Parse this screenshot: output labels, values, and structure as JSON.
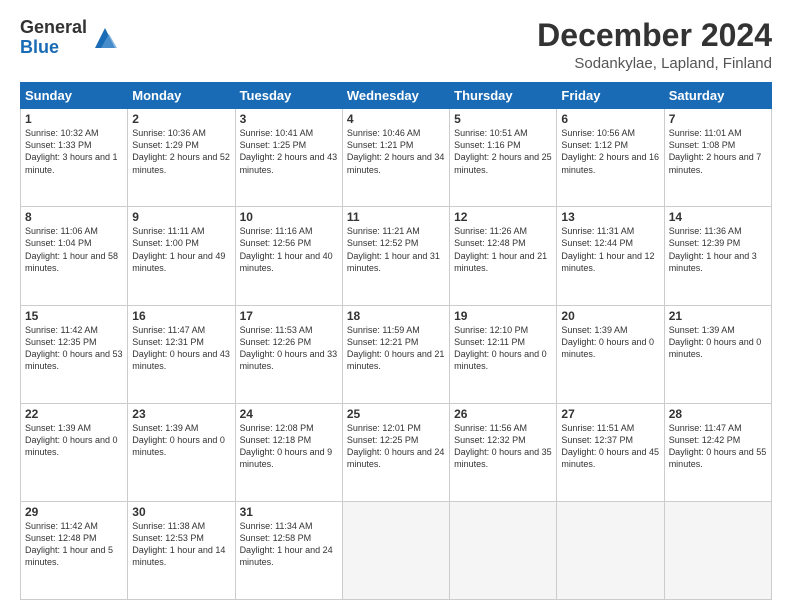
{
  "logo": {
    "general": "General",
    "blue": "Blue"
  },
  "title": "December 2024",
  "subtitle": "Sodankylae, Lapland, Finland",
  "days_of_week": [
    "Sunday",
    "Monday",
    "Tuesday",
    "Wednesday",
    "Thursday",
    "Friday",
    "Saturday"
  ],
  "weeks": [
    [
      {
        "day": "1",
        "info": "Sunrise: 10:32 AM\nSunset: 1:33 PM\nDaylight: 3 hours and 1 minute."
      },
      {
        "day": "2",
        "info": "Sunrise: 10:36 AM\nSunset: 1:29 PM\nDaylight: 2 hours and 52 minutes."
      },
      {
        "day": "3",
        "info": "Sunrise: 10:41 AM\nSunset: 1:25 PM\nDaylight: 2 hours and 43 minutes."
      },
      {
        "day": "4",
        "info": "Sunrise: 10:46 AM\nSunset: 1:21 PM\nDaylight: 2 hours and 34 minutes."
      },
      {
        "day": "5",
        "info": "Sunrise: 10:51 AM\nSunset: 1:16 PM\nDaylight: 2 hours and 25 minutes."
      },
      {
        "day": "6",
        "info": "Sunrise: 10:56 AM\nSunset: 1:12 PM\nDaylight: 2 hours and 16 minutes."
      },
      {
        "day": "7",
        "info": "Sunrise: 11:01 AM\nSunset: 1:08 PM\nDaylight: 2 hours and 7 minutes."
      }
    ],
    [
      {
        "day": "8",
        "info": "Sunrise: 11:06 AM\nSunset: 1:04 PM\nDaylight: 1 hour and 58 minutes."
      },
      {
        "day": "9",
        "info": "Sunrise: 11:11 AM\nSunset: 1:00 PM\nDaylight: 1 hour and 49 minutes."
      },
      {
        "day": "10",
        "info": "Sunrise: 11:16 AM\nSunset: 12:56 PM\nDaylight: 1 hour and 40 minutes."
      },
      {
        "day": "11",
        "info": "Sunrise: 11:21 AM\nSunset: 12:52 PM\nDaylight: 1 hour and 31 minutes."
      },
      {
        "day": "12",
        "info": "Sunrise: 11:26 AM\nSunset: 12:48 PM\nDaylight: 1 hour and 21 minutes."
      },
      {
        "day": "13",
        "info": "Sunrise: 11:31 AM\nSunset: 12:44 PM\nDaylight: 1 hour and 12 minutes."
      },
      {
        "day": "14",
        "info": "Sunrise: 11:36 AM\nSunset: 12:39 PM\nDaylight: 1 hour and 3 minutes."
      }
    ],
    [
      {
        "day": "15",
        "info": "Sunrise: 11:42 AM\nSunset: 12:35 PM\nDaylight: 0 hours and 53 minutes."
      },
      {
        "day": "16",
        "info": "Sunrise: 11:47 AM\nSunset: 12:31 PM\nDaylight: 0 hours and 43 minutes."
      },
      {
        "day": "17",
        "info": "Sunrise: 11:53 AM\nSunset: 12:26 PM\nDaylight: 0 hours and 33 minutes."
      },
      {
        "day": "18",
        "info": "Sunrise: 11:59 AM\nSunset: 12:21 PM\nDaylight: 0 hours and 21 minutes."
      },
      {
        "day": "19",
        "info": "Sunrise: 12:10 PM\nSunset: 12:11 PM\nDaylight: 0 hours and 0 minutes."
      },
      {
        "day": "20",
        "info": "Sunset: 1:39 AM\nDaylight: 0 hours and 0 minutes."
      },
      {
        "day": "21",
        "info": "Sunset: 1:39 AM\nDaylight: 0 hours and 0 minutes."
      }
    ],
    [
      {
        "day": "22",
        "info": "Sunset: 1:39 AM\nDaylight: 0 hours and 0 minutes."
      },
      {
        "day": "23",
        "info": "Sunset: 1:39 AM\nDaylight: 0 hours and 0 minutes."
      },
      {
        "day": "24",
        "info": "Sunrise: 12:08 PM\nSunset: 12:18 PM\nDaylight: 0 hours and 9 minutes."
      },
      {
        "day": "25",
        "info": "Sunrise: 12:01 PM\nSunset: 12:25 PM\nDaylight: 0 hours and 24 minutes."
      },
      {
        "day": "26",
        "info": "Sunrise: 11:56 AM\nSunset: 12:32 PM\nDaylight: 0 hours and 35 minutes."
      },
      {
        "day": "27",
        "info": "Sunrise: 11:51 AM\nSunset: 12:37 PM\nDaylight: 0 hours and 45 minutes."
      },
      {
        "day": "28",
        "info": "Sunrise: 11:47 AM\nSunset: 12:42 PM\nDaylight: 0 hours and 55 minutes."
      }
    ],
    [
      {
        "day": "29",
        "info": "Sunrise: 11:42 AM\nSunset: 12:48 PM\nDaylight: 1 hour and 5 minutes."
      },
      {
        "day": "30",
        "info": "Sunrise: 11:38 AM\nSunset: 12:53 PM\nDaylight: 1 hour and 14 minutes."
      },
      {
        "day": "31",
        "info": "Sunrise: 11:34 AM\nSunset: 12:58 PM\nDaylight: 1 hour and 24 minutes."
      },
      null,
      null,
      null,
      null
    ]
  ]
}
